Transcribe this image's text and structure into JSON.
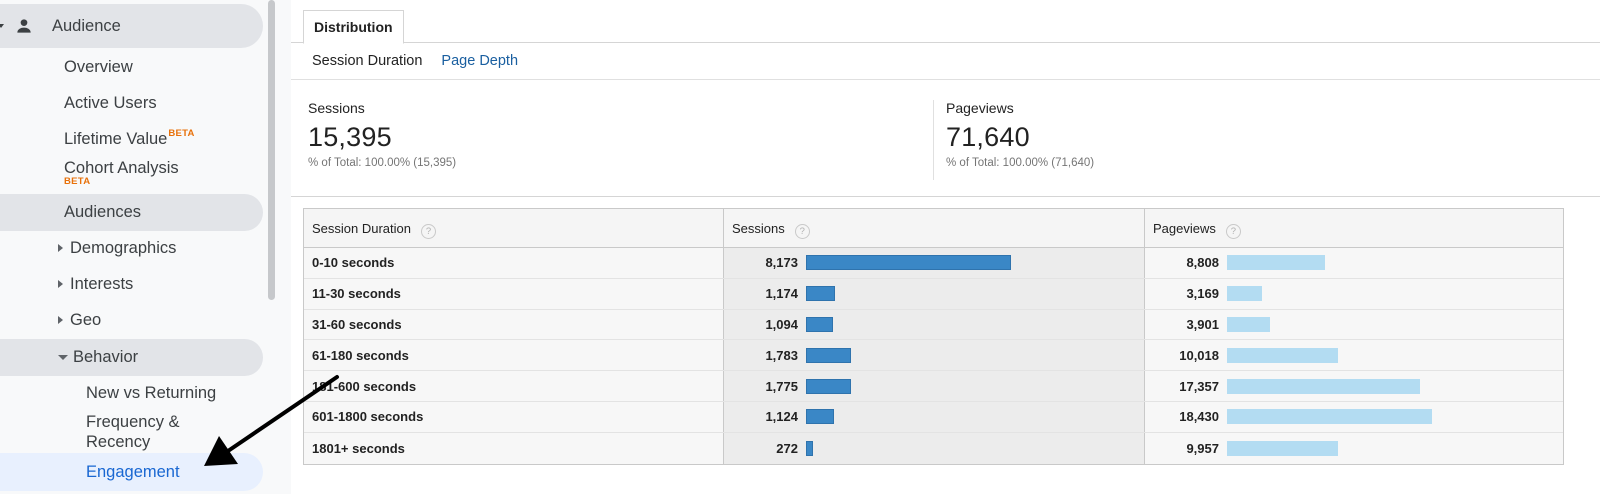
{
  "sidebar": {
    "section": "Audience",
    "items": [
      {
        "label": "Overview"
      },
      {
        "label": "Active Users"
      },
      {
        "label": "Lifetime Value",
        "badge": "BETA"
      },
      {
        "label": "Cohort Analysis",
        "badge": "BETA"
      },
      {
        "label": "Audiences"
      },
      {
        "label": "Demographics"
      },
      {
        "label": "Interests"
      },
      {
        "label": "Geo"
      },
      {
        "label": "Behavior"
      }
    ],
    "behavior_children": [
      {
        "label": "New vs Returning"
      },
      {
        "label": "Frequency &"
      },
      {
        "label": "Recency"
      },
      {
        "label": "Engagement"
      }
    ]
  },
  "tabs": {
    "active": "Distribution"
  },
  "subnav": {
    "active": "Session Duration",
    "link": "Page Depth"
  },
  "metrics": [
    {
      "label": "Sessions",
      "value": "15,395",
      "sub": "% of Total: 100.00% (15,395)"
    },
    {
      "label": "Pageviews",
      "value": "71,640",
      "sub": "% of Total: 100.00% (71,640)"
    }
  ],
  "table": {
    "headers": [
      "Session Duration",
      "Sessions",
      "Pageviews"
    ],
    "help": "?",
    "rows": [
      {
        "duration": "0-10 seconds",
        "sessions": "8,173",
        "sessions_value": 8173,
        "pageviews": "8,808",
        "pageviews_value": 8808
      },
      {
        "duration": "11-30 seconds",
        "sessions": "1,174",
        "sessions_value": 1174,
        "pageviews": "3,169",
        "pageviews_value": 3169
      },
      {
        "duration": "31-60 seconds",
        "sessions": "1,094",
        "sessions_value": 1094,
        "pageviews": "3,901",
        "pageviews_value": 3901
      },
      {
        "duration": "61-180 seconds",
        "sessions": "1,783",
        "sessions_value": 1783,
        "pageviews": "10,018",
        "pageviews_value": 10018
      },
      {
        "duration": "181-600 seconds",
        "sessions": "1,775",
        "sessions_value": 1775,
        "pageviews": "17,357",
        "pageviews_value": 17357
      },
      {
        "duration": "601-1800 seconds",
        "sessions": "1,124",
        "sessions_value": 1124,
        "pageviews": "18,430",
        "pageviews_value": 18430
      },
      {
        "duration": "1801+ seconds",
        "sessions": "272",
        "sessions_value": 272,
        "pageviews": "9,957",
        "pageviews_value": 9957
      }
    ]
  },
  "colors": {
    "sessions_bar": "#3a87c6",
    "pageviews_bar": "#b3dcf2",
    "link": "#1a5fa0",
    "beta": "#e8710a",
    "active_nav": "#1967d2"
  }
}
